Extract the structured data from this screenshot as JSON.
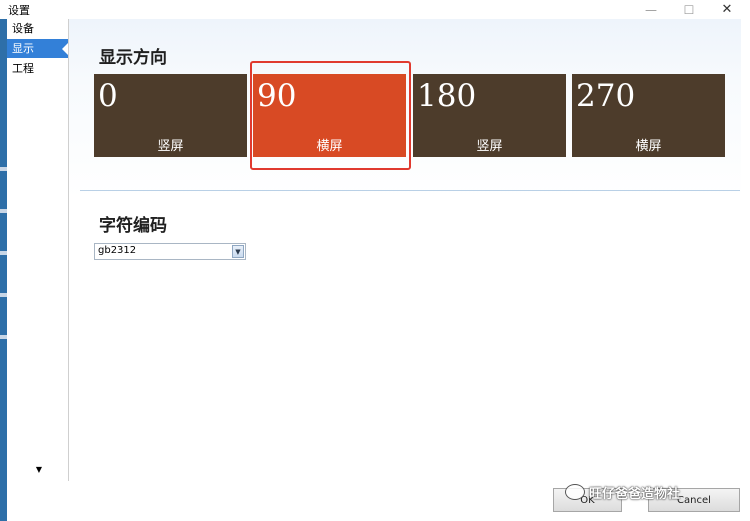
{
  "window": {
    "title": "设置"
  },
  "sidebar": {
    "items": [
      {
        "label": "设备",
        "selected": false
      },
      {
        "label": "显示",
        "selected": true
      },
      {
        "label": "工程",
        "selected": false
      }
    ]
  },
  "display_orientation": {
    "title": "显示方向",
    "options": [
      {
        "value": "0",
        "label": "竖屏",
        "selected": false
      },
      {
        "value": "90",
        "label": "横屏",
        "selected": true
      },
      {
        "value": "180",
        "label": "竖屏",
        "selected": false
      },
      {
        "value": "270",
        "label": "横屏",
        "selected": false
      }
    ]
  },
  "character_encoding": {
    "title": "字符编码",
    "selected": "gb2312"
  },
  "buttons": {
    "ok": "OK",
    "cancel": "Cancel"
  },
  "watermark": {
    "text": "旺仔爸爸造物社"
  },
  "colors": {
    "tile": "#4d3c2b",
    "tile_selected": "#d84a24",
    "highlight": "#e03a2f",
    "sidebar_selected": "#3380d8"
  },
  "icons": {
    "close": "close-icon",
    "minimize": "minimize-icon",
    "maximize": "maximize-icon",
    "dropdown": "chevron-down-icon"
  }
}
